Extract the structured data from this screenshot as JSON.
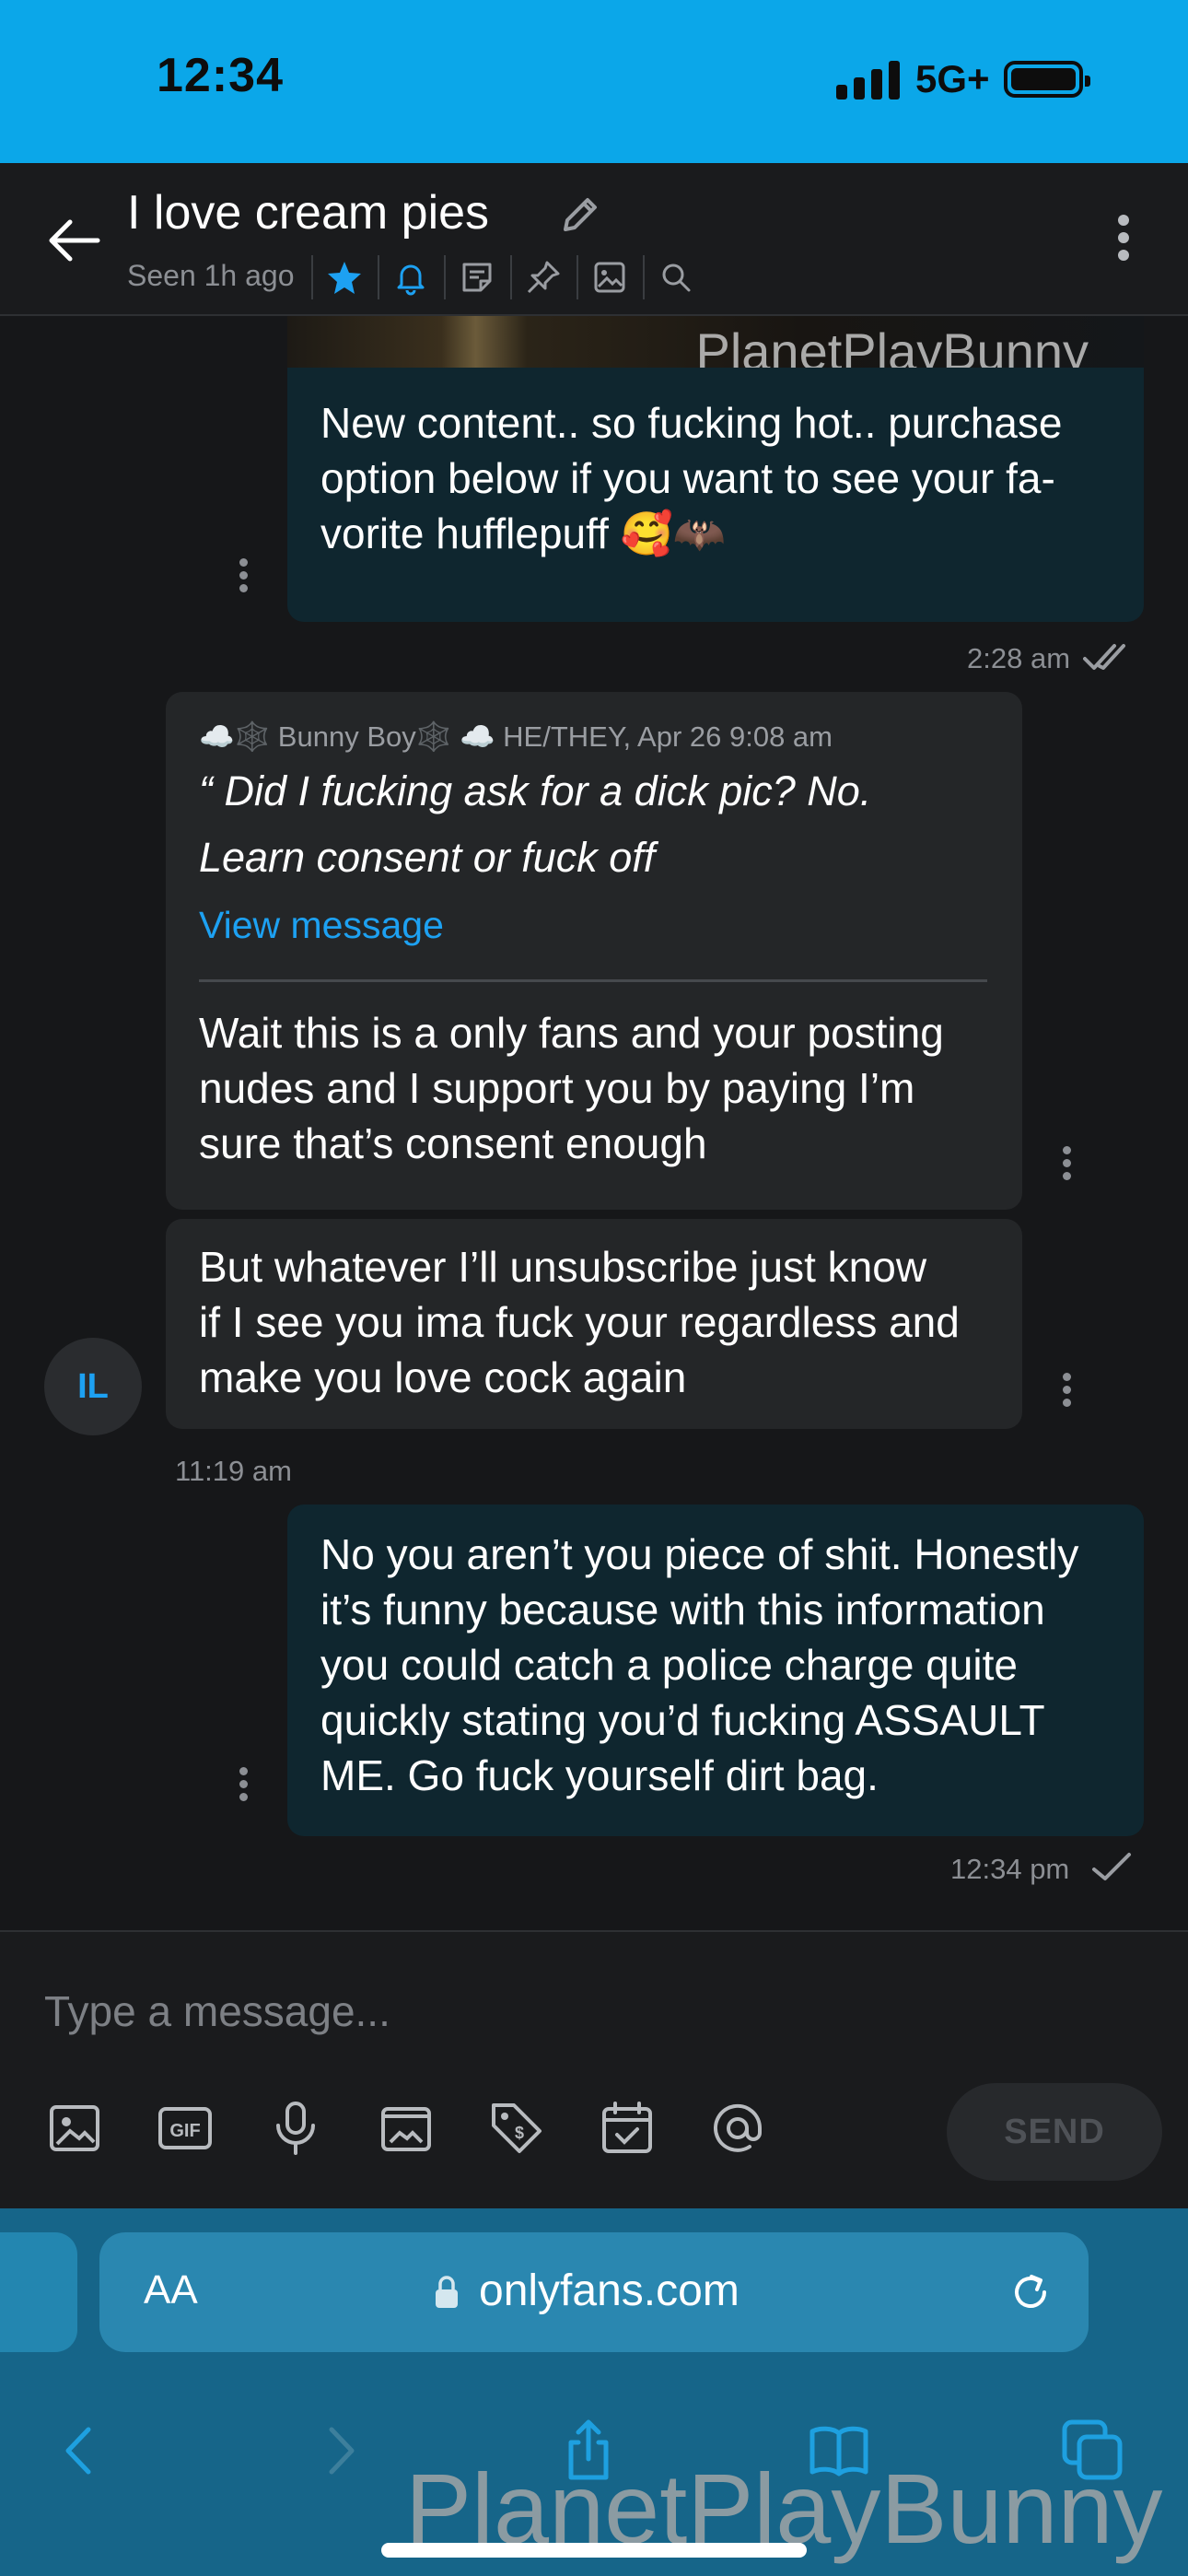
{
  "status_bar": {
    "time": "12:34",
    "network": "5G+"
  },
  "header": {
    "title": "I love cream pies",
    "subtitle": "Seen 1h ago",
    "icons": [
      "star-icon",
      "bell-icon",
      "note-icon",
      "pin-icon",
      "image-icon",
      "search-icon"
    ],
    "accent": "#1da1f2"
  },
  "messages": [
    {
      "id": "m1",
      "direction": "outgoing",
      "media_watermark": "PlanetPlayBunny",
      "text_lines": [
        "New content.. so fucking hot.. purchase",
        "option below if you want to see your fa-",
        "vorite hufflepuff 🥰🦇"
      ],
      "time": "2:28 am",
      "status": "read"
    },
    {
      "id": "m2",
      "direction": "incoming",
      "quote": {
        "author_line": "☁️🕸️ Bunny Boy🕸️ ☁️ HE/THEY, Apr 26 9:08 am",
        "text_lines": [
          "“ Did I fucking ask for a dick pic? No.",
          "Learn consent or fuck off"
        ],
        "link": "View message"
      },
      "text_lines": [
        "Wait this is a only fans and your posting",
        "nudes and I support you by paying I’m",
        "sure that’s consent enough"
      ]
    },
    {
      "id": "m3",
      "direction": "incoming",
      "text_lines": [
        "But whatever I’ll unsubscribe just know",
        "if I see you ima fuck your regardless and",
        "make you love cock again"
      ],
      "avatar_initials": "IL",
      "time": "11:19 am"
    },
    {
      "id": "m4",
      "direction": "outgoing",
      "text_lines": [
        "No you aren’t you piece of shit. Honestly",
        "it’s funny because with this information",
        "you could catch a police charge quite",
        "quickly stating you’d fucking ASSAULT",
        "ME. Go fuck yourself dirt bag."
      ],
      "time": "12:34 pm",
      "status": "sent"
    }
  ],
  "composer": {
    "placeholder": "Type a message...",
    "tools": [
      "image-icon",
      "gif-icon",
      "microphone-icon",
      "vault-icon",
      "price-tag-icon",
      "calendar-icon",
      "mention-icon"
    ],
    "send_label": "SEND"
  },
  "browser": {
    "aa_label": "AA",
    "url": "onlyfans.com",
    "nav": [
      "back-icon",
      "forward-icon",
      "share-icon",
      "bookmarks-icon",
      "tabs-icon"
    ]
  },
  "overlay": {
    "watermark": "PlanetPlayBunny"
  }
}
